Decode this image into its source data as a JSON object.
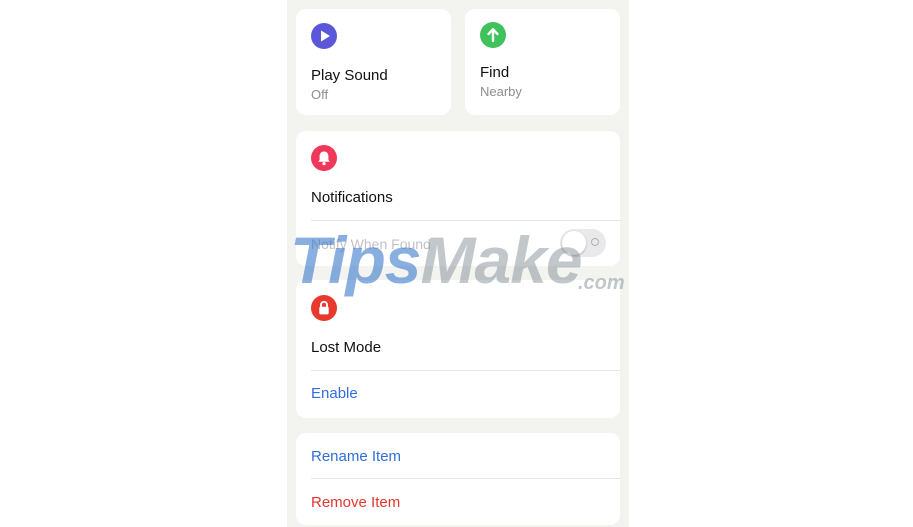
{
  "play_sound": {
    "title": "Play Sound",
    "status": "Off",
    "icon": "play-icon",
    "icon_color": "#5856d6"
  },
  "find": {
    "title": "Find",
    "status": "Nearby",
    "icon": "arrow-up-icon",
    "icon_color": "#34c759"
  },
  "notifications": {
    "title": "Notifications",
    "row_label": "Notify When Found",
    "toggle_on": false,
    "icon": "bell-icon",
    "icon_color": "#ff375f"
  },
  "lost_mode": {
    "title": "Lost Mode",
    "action": "Enable",
    "icon": "lock-icon",
    "icon_color": "#ff3b30"
  },
  "item_actions": {
    "rename": "Rename Item",
    "remove": "Remove Item"
  },
  "colors": {
    "link_blue": "#2f6fdc",
    "destructive_red": "#e5342d"
  },
  "watermark": {
    "part1": "Tips",
    "part2": "Make",
    "suffix": ".com"
  }
}
